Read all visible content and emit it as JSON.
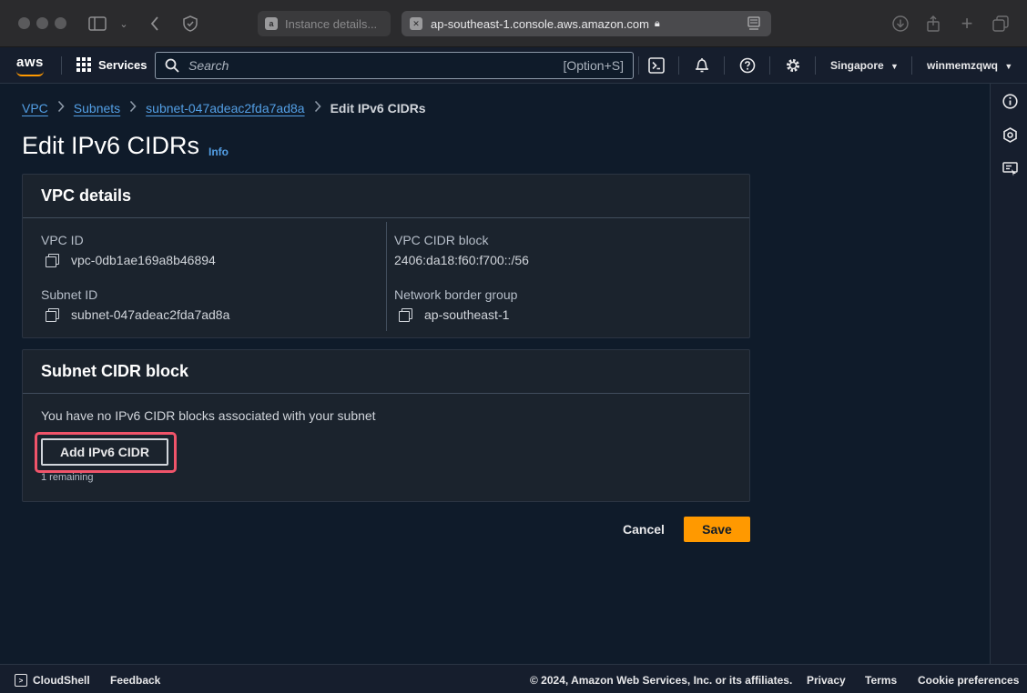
{
  "browser": {
    "tabs": [
      {
        "label": "Instance details..."
      },
      {
        "label": "ap-southeast-1.console.aws.amazon.com",
        "active": true
      }
    ]
  },
  "topnav": {
    "logo": "aws",
    "services_label": "Services",
    "search": {
      "placeholder": "Search",
      "shortcut": "[Option+S]"
    },
    "region": "Singapore",
    "user": "winmemzqwq"
  },
  "breadcrumb": {
    "items": [
      "VPC",
      "Subnets",
      "subnet-047adeac2fda7ad8a"
    ],
    "current": "Edit IPv6 CIDRs"
  },
  "page": {
    "title": "Edit IPv6 CIDRs",
    "info_label": "Info"
  },
  "vpc_details": {
    "header": "VPC details",
    "vpc_id_label": "VPC ID",
    "vpc_id": "vpc-0db1ae169a8b46894",
    "subnet_id_label": "Subnet ID",
    "subnet_id": "subnet-047adeac2fda7ad8a",
    "cidr_label": "VPC CIDR block",
    "cidr": "2406:da18:f60:f700::/56",
    "border_group_label": "Network border group",
    "border_group": "ap-southeast-1"
  },
  "subnet_cidr": {
    "header": "Subnet CIDR block",
    "message": "You have no IPv6 CIDR blocks associated with your subnet",
    "add_button": "Add IPv6 CIDR",
    "remaining": "1 remaining"
  },
  "actions": {
    "cancel": "Cancel",
    "save": "Save"
  },
  "footer": {
    "cloudshell": "CloudShell",
    "feedback": "Feedback",
    "copyright": "© 2024, Amazon Web Services, Inc. or its affiliates.",
    "privacy": "Privacy",
    "terms": "Terms",
    "cookies": "Cookie preferences"
  },
  "colors": {
    "accent": "#ff9900",
    "link": "#539fe5",
    "highlight": "#f0546a"
  }
}
